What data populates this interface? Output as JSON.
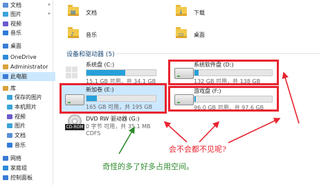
{
  "sidebar": {
    "items": [
      {
        "label": "文档",
        "icon": "document-icon",
        "pinned": true,
        "color": "#5b8fd6"
      },
      {
        "label": "图片",
        "icon": "picture-icon",
        "pinned": true,
        "color": "#3aa3d8"
      },
      {
        "label": "视频",
        "icon": "video-icon",
        "pinned": false,
        "color": "#6a5acd"
      },
      {
        "label": "音乐",
        "icon": "music-icon",
        "pinned": false,
        "color": "#2f7bd8"
      },
      {
        "label": "桌面",
        "icon": "desktop-icon",
        "pinned": false,
        "color": "#3a7bd5"
      },
      {
        "label": "OneDrive",
        "icon": "cloud-icon",
        "pinned": false,
        "color": "#2e8bd8"
      },
      {
        "label": "Administrator",
        "icon": "user-icon",
        "pinned": false,
        "color": "#d8a23a"
      },
      {
        "label": "此电脑",
        "icon": "computer-icon",
        "pinned": false,
        "color": "#3a7bd5",
        "selected": true
      },
      {
        "label": "库",
        "icon": "library-icon",
        "pinned": false,
        "color": "#d8a23a"
      },
      {
        "label": "保存的图片",
        "icon": "picture-icon",
        "pinned": false,
        "color": "#3aa3d8"
      },
      {
        "label": "本机照片",
        "icon": "picture-icon",
        "pinned": false,
        "color": "#3aa3d8"
      },
      {
        "label": "视频",
        "icon": "video-icon",
        "pinned": false,
        "color": "#6a5acd"
      },
      {
        "label": "图片",
        "icon": "picture-icon",
        "pinned": false,
        "color": "#3aa3d8"
      },
      {
        "label": "文档",
        "icon": "document-icon",
        "pinned": false,
        "color": "#5b8fd6"
      },
      {
        "label": "音乐",
        "icon": "music-icon",
        "pinned": false,
        "color": "#2f7bd8"
      },
      {
        "label": "网络",
        "icon": "network-icon",
        "pinned": false,
        "color": "#3a7bd5"
      },
      {
        "label": "家庭组",
        "icon": "homegroup-icon",
        "pinned": false,
        "color": "#2e8bd8"
      },
      {
        "label": "控制面板",
        "icon": "control-panel-icon",
        "pinned": false,
        "color": "#3a7bd5"
      }
    ]
  },
  "folders": [
    {
      "label": "文档",
      "icon": "document-folder-icon"
    },
    {
      "label": "下载",
      "icon": "download-folder-icon"
    },
    {
      "label": "音乐",
      "icon": "music-folder-icon"
    },
    {
      "label": "桌面",
      "icon": "desktop-folder-icon"
    }
  ],
  "devices_section": {
    "title": "设备和驱动器 (5)"
  },
  "drives": [
    {
      "name": "系统盘 (C:)",
      "free": "15.1 GB 可用，共 34.1 GB",
      "used_fraction": 0.56
    },
    {
      "name": "系统软件盘 (D:)",
      "free": "132 GB 可用，共 138 GB",
      "used_fraction": 0.05
    },
    {
      "name": "新加卷 (E:)",
      "free": "165 GB 可用，共 195 GB",
      "used_fraction": 0.15
    },
    {
      "name": "游戏盘 (F:)",
      "free": "96.0 GB 可用，共 97.6 GB",
      "used_fraction": 0.02
    },
    {
      "name": "DVD RW 驱动器 (G:)",
      "free": "0 字节 可用，共 35.1 MB",
      "fs": "CDFS",
      "badge": "CD-ROM"
    }
  ],
  "annotations": {
    "red_text": "会不会都不见呢?",
    "green_text": "奇怪的多了好多占用空间。"
  },
  "colors": {
    "accent_bar": "#26a0da",
    "annotation_red": "#e8232f",
    "annotation_green": "#2e8b2e",
    "selection": "#cce8ff"
  }
}
